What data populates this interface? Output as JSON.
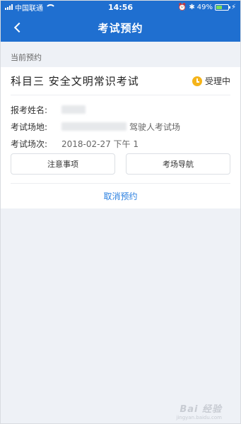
{
  "status_bar": {
    "carrier": "中国联通",
    "time": "14:56",
    "battery": "49%"
  },
  "nav": {
    "title": "考试预约"
  },
  "section_label": "当前预约",
  "appointment": {
    "title": "科目三 安全文明常识考试",
    "status": "受理中",
    "fields": [
      {
        "label": "报考姓名:",
        "value": ""
      },
      {
        "label": "考试场地:",
        "value": "驾驶人考试场"
      },
      {
        "label": "考试场次:",
        "value": "2018-02-27 下午 1"
      }
    ],
    "buttons": {
      "notes": "注意事项",
      "navigation": "考场导航"
    },
    "cancel": "取消预约"
  },
  "watermark": {
    "text": "Bai 经验",
    "sub": "jingyan.baidu.com"
  },
  "colors": {
    "brand": "#1f6fd0",
    "link": "#2a7fe0",
    "pending": "#f5b41a"
  }
}
